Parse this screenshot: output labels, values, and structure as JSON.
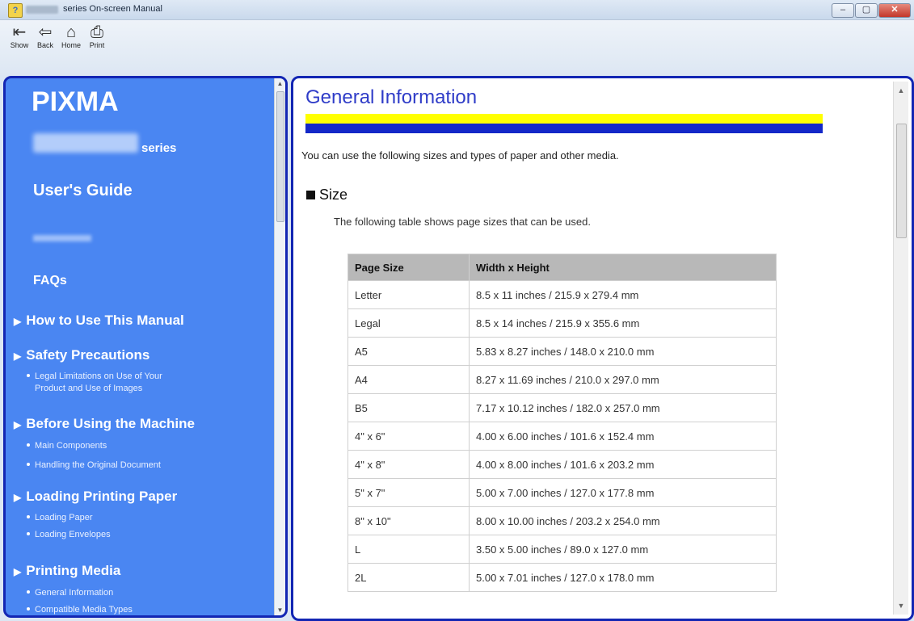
{
  "window": {
    "title": "series On-screen Manual",
    "min": "–",
    "max": "▢",
    "close": "✕"
  },
  "toolbar": {
    "show_label": "Show",
    "back_label": "Back",
    "home_label": "Home",
    "print_label": "Print"
  },
  "sidebar": {
    "brand": "PIXMA",
    "series": "series",
    "guide": "User's Guide",
    "faqs": "FAQs",
    "sections": [
      {
        "label": "How to Use This Manual",
        "subs": []
      },
      {
        "label": "Safety Precautions",
        "subs": [
          "Legal Limitations on Use of Your",
          "Product and Use of Images"
        ]
      },
      {
        "label": "Before Using the Machine",
        "subs": [
          "Main Components",
          "Handling the Original Document"
        ]
      },
      {
        "label": "Loading Printing Paper",
        "subs": [
          "Loading Paper",
          "Loading Envelopes"
        ]
      },
      {
        "label": "Printing Media",
        "subs": [
          "General Information",
          "Compatible Media Types"
        ]
      }
    ]
  },
  "content": {
    "title": "General Information",
    "intro": "You can use the following sizes and types of paper and other media.",
    "section_title": "Size",
    "section_desc": "The following table shows page sizes that can be used.",
    "table": {
      "headers": [
        "Page Size",
        "Width x Height"
      ],
      "rows": [
        [
          "Letter",
          "8.5 x 11 inches / 215.9 x 279.4 mm"
        ],
        [
          "Legal",
          "8.5 x 14 inches / 215.9 x 355.6 mm"
        ],
        [
          "A5",
          "5.83 x 8.27 inches / 148.0 x 210.0 mm"
        ],
        [
          "A4",
          "8.27 x 11.69 inches / 210.0 x 297.0 mm"
        ],
        [
          "B5",
          "7.17 x 10.12 inches / 182.0 x 257.0 mm"
        ],
        [
          "4\" x 6\"",
          "4.00 x 6.00 inches / 101.6 x 152.4 mm"
        ],
        [
          "4\" x 8\"",
          "4.00 x 8.00 inches / 101.6 x 203.2 mm"
        ],
        [
          "5\" x 7\"",
          "5.00 x 7.00 inches / 127.0 x 177.8 mm"
        ],
        [
          "8\" x 10\"",
          "8.00 x 10.00 inches / 203.2 x 254.0 mm"
        ],
        [
          "L",
          "3.50 x 5.00 inches / 89.0 x 127.0 mm"
        ],
        [
          "2L",
          "5.00 x 7.01 inches / 127.0 x 178.0 mm"
        ]
      ]
    }
  },
  "colors": {
    "sidebar_bg": "#4a86f2",
    "pane_border": "#1326b3",
    "title_color": "#2f3cc8",
    "bar_yellow": "#ffff00",
    "bar_blue": "#1428c8"
  }
}
